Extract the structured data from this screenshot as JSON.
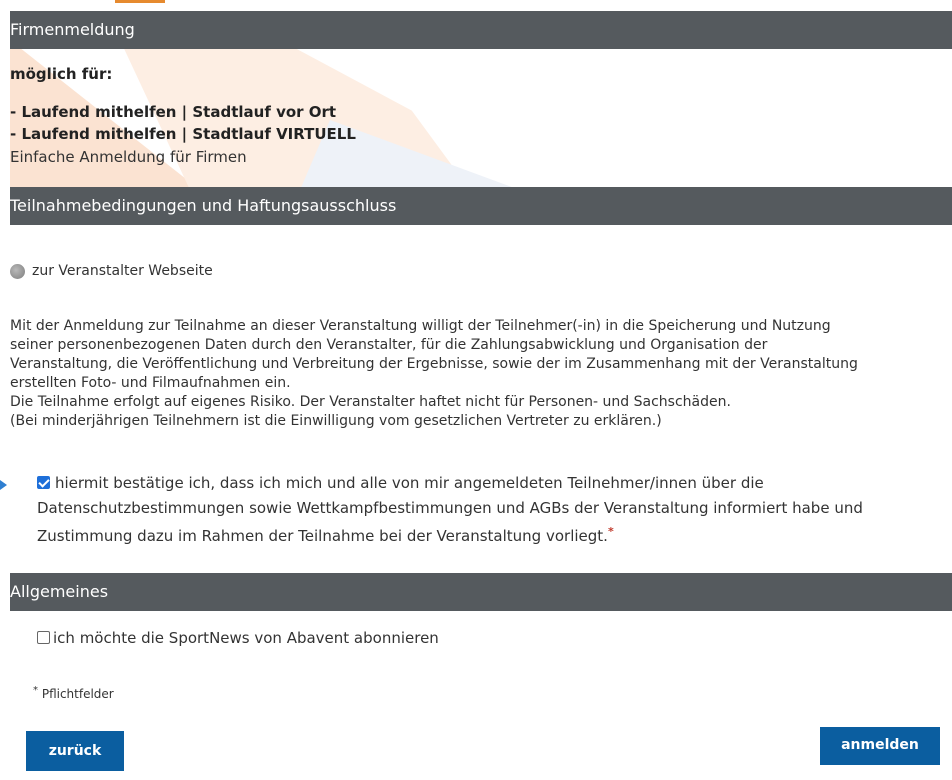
{
  "header": {
    "title": "Firmenmeldung"
  },
  "info": {
    "possible_label": "möglich für:",
    "options": [
      "- Laufend mithelfen | Stadtlauf vor Ort",
      "- Laufend mithelfen | Stadtlauf VIRTUELL"
    ],
    "description": "Einfache Anmeldung für Firmen"
  },
  "terms": {
    "title": "Teilnahmebedingungen und Haftungsausschluss",
    "website_link": "zur Veranstalter Webseite",
    "paragraph_lines": [
      "Mit der Anmeldung zur Teilnahme an dieser Veranstaltung willigt der Teilnehmer(-in) in die Speicherung und Nutzung",
      "seiner personenbezogenen Daten durch den Veranstalter, für die Zahlungsabwicklung und Organisation der",
      "Veranstaltung, die Veröffentlichung und Verbreitung der Ergebnisse, sowie der im Zusammenhang mit der Veranstaltung",
      "erstellten Foto- und Filmaufnahmen ein.",
      "Die Teilnahme erfolgt auf eigenes Risiko. Der Veranstalter haftet nicht für Personen- und Sachschäden.",
      "(Bei minderjährigen Teilnehmern ist die Einwilligung vom gesetzlichen Vertreter zu erklären.)"
    ],
    "consent_lines": [
      "hiermit bestätige ich, dass ich mich und alle von mir angemeldeten Teilnehmer/innen über die",
      "Datenschutzbestimmungen sowie Wettkampfbestimmungen und AGBs der Veranstaltung informiert habe und",
      "Zustimmung dazu im Rahmen der Teilnahme bei der Veranstaltung vorliegt."
    ],
    "required_marker": "*",
    "consent_checked": true
  },
  "general": {
    "title": "Allgemeines",
    "newsletter_label": "ich möchte die SportNews von Abavent abonnieren",
    "newsletter_checked": false
  },
  "footer": {
    "required_marker": "*",
    "required_note": "Pflichtfelder",
    "back_label": "zurück",
    "submit_label": "anmelden"
  },
  "colors": {
    "header_bg": "#555a5e",
    "button_bg": "#0b5ea0",
    "checkbox_checked": "#1e6fd9",
    "required": "#c0392b"
  }
}
